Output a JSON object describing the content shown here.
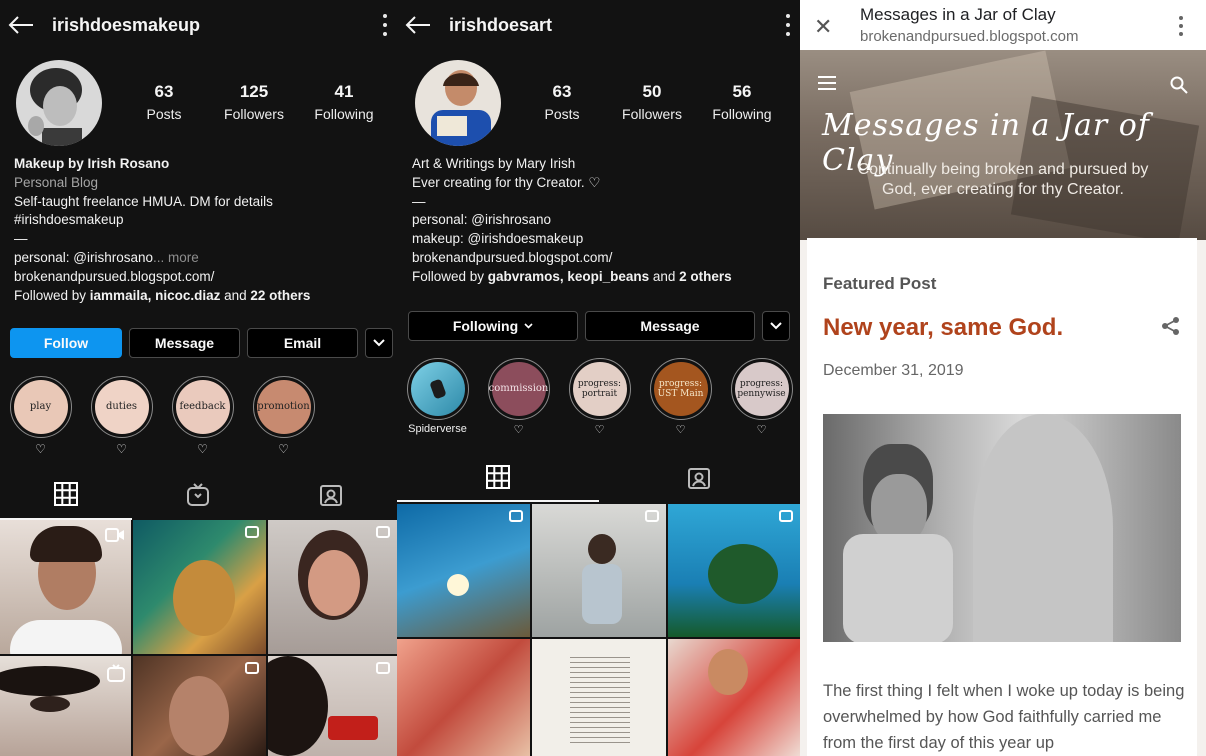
{
  "panel1": {
    "handle": "irishdoesmakeup",
    "stats": [
      {
        "num": "63",
        "label": "Posts"
      },
      {
        "num": "125",
        "label": "Followers"
      },
      {
        "num": "41",
        "label": "Following"
      }
    ],
    "bio": {
      "name": "Makeup by Irish Rosano",
      "category": "Personal Blog",
      "line1": "Self-taught freelance HMUA. DM for details",
      "line2": "#irishdoesmakeup",
      "line3": "—",
      "line4": "personal: @irishrosano",
      "more": "... more",
      "link": "brokenandpursued.blogspot.com/",
      "followed_prefix": "Followed by ",
      "followed_users": "iammaila, nicoc.diaz",
      "followed_and": " and ",
      "followed_others": "22 others"
    },
    "buttons": {
      "follow": "Follow",
      "message": "Message",
      "email": "Email"
    },
    "highlights": [
      {
        "label": "play",
        "color": "#e9c8b7"
      },
      {
        "label": "duties",
        "color": "#efd3c6"
      },
      {
        "label": "feedback",
        "color": "#eacabd"
      },
      {
        "label": "promotion",
        "color": "#c78a70"
      }
    ],
    "heart": "♡"
  },
  "panel2": {
    "handle": "irishdoesart",
    "stats": [
      {
        "num": "63",
        "label": "Posts"
      },
      {
        "num": "50",
        "label": "Followers"
      },
      {
        "num": "56",
        "label": "Following"
      }
    ],
    "bio": {
      "name": "Art & Writings by Mary Irish",
      "line1": "Ever creating for thy Creator. ♡",
      "line2": "—",
      "line3": "personal: @irishrosano",
      "line4": "makeup: @irishdoesmakeup",
      "link": "brokenandpursued.blogspot.com/",
      "followed_prefix": "Followed by ",
      "followed_users": "gabvramos, keopi_beans",
      "followed_and": " and ",
      "followed_others": "2 others"
    },
    "buttons": {
      "following": "Following",
      "message": "Message"
    },
    "highlights": [
      {
        "label": "",
        "caption": "Spiderverse",
        "color": "#58b3cf"
      },
      {
        "label": "commission",
        "caption": "♡",
        "color": "#8c4d5c"
      },
      {
        "label": "progress: portrait",
        "caption": "♡",
        "color": "#e3cfc6"
      },
      {
        "label": "progress: UST Main",
        "caption": "♡",
        "color": "#a4561f"
      },
      {
        "label": "progress: pennywise",
        "caption": "♡",
        "color": "#d8c9c9"
      }
    ]
  },
  "blog": {
    "page_title": "Messages in a Jar of Clay",
    "url": "brokenandpursued.blogspot.com",
    "header_title": "Messages in a Jar of Clay",
    "tagline_1": "Continually being broken and pursued by",
    "tagline_2": "God, ever creating for thy Creator.",
    "featured": "Featured Post",
    "post_title": "New year, same God.",
    "date": "December 31, 2019",
    "excerpt": "The first thing I felt when I woke up today is being overwhelmed by how God faithfully carried me from the first day of this year up"
  }
}
